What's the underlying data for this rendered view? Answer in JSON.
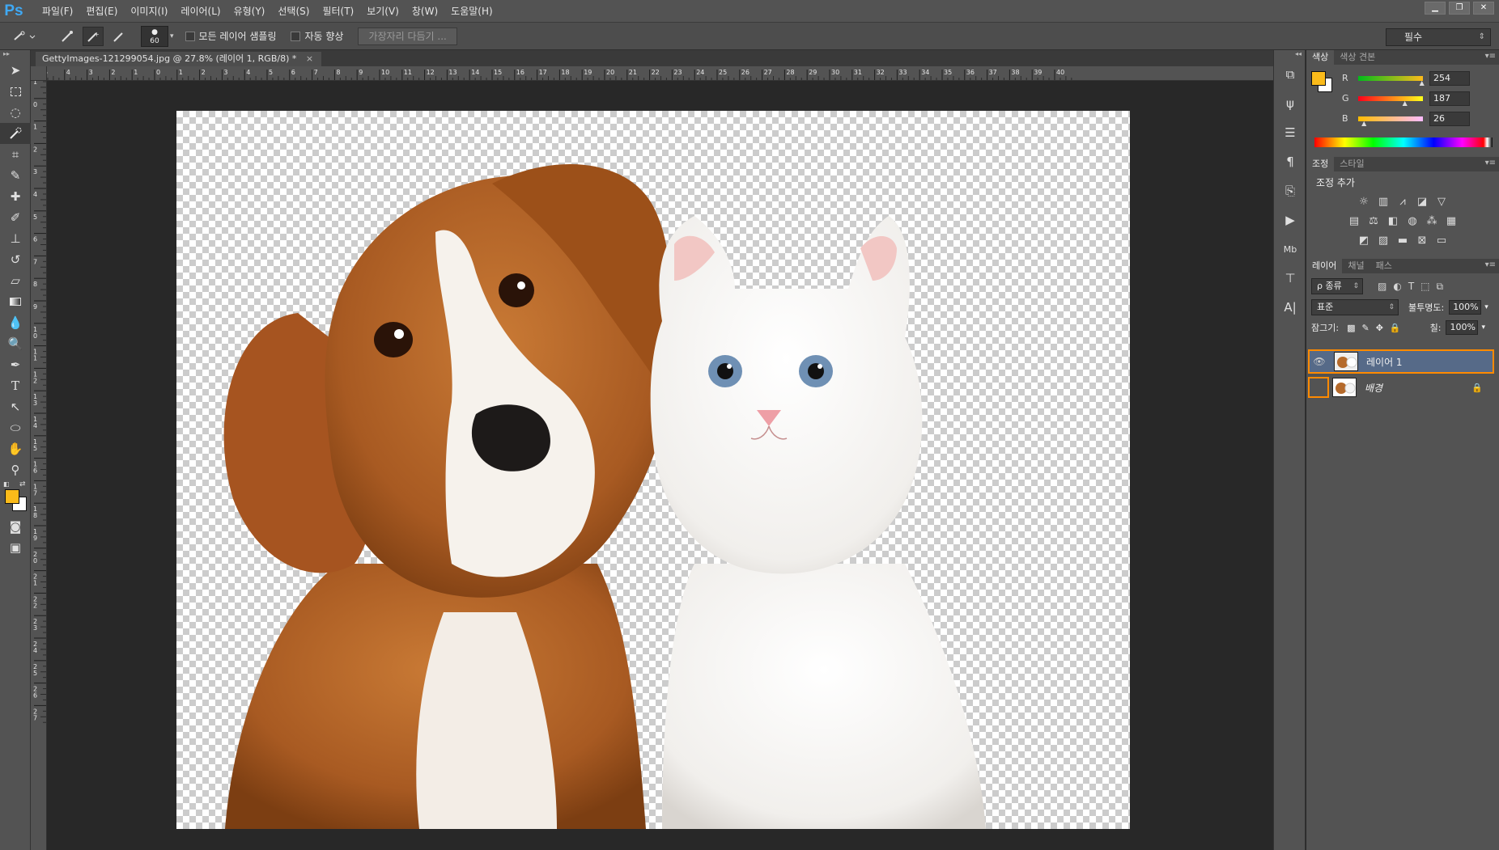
{
  "app": {
    "logo": "Ps"
  },
  "menu": [
    "파일(F)",
    "편집(E)",
    "이미지(I)",
    "레이어(L)",
    "유형(Y)",
    "선택(S)",
    "필터(T)",
    "보기(V)",
    "창(W)",
    "도움말(H)"
  ],
  "options": {
    "brush_size": "60",
    "sample_all_layers": "모든 레이어 샘플링",
    "auto_enhance": "자동 향상",
    "refine_edge": "가장자리 다듬기 ...",
    "workspace": "필수"
  },
  "document": {
    "tab_title": "GettyImages-121299054.jpg @ 27.8% (레이어 1, RGB/8) *",
    "close": "×"
  },
  "ruler": {
    "h_ticks": [
      "5",
      "4",
      "3",
      "2",
      "1",
      "0",
      "1",
      "2",
      "3",
      "4",
      "5",
      "6",
      "7",
      "8",
      "9",
      "10",
      "11",
      "12",
      "13",
      "14",
      "15",
      "16",
      "17",
      "18",
      "19",
      "20",
      "21",
      "22",
      "23",
      "24",
      "25",
      "26",
      "27",
      "28",
      "29",
      "30",
      "31",
      "32",
      "33",
      "34",
      "35",
      "36",
      "37",
      "38",
      "39",
      "40"
    ],
    "v_ticks": [
      "1",
      "0",
      "1",
      "2",
      "3",
      "4",
      "5",
      "6",
      "7",
      "8",
      "9",
      "10",
      "11",
      "12",
      "13",
      "14",
      "15",
      "16",
      "17",
      "18",
      "19",
      "20",
      "21",
      "22",
      "23",
      "24",
      "25",
      "26",
      "27"
    ]
  },
  "colors": {
    "foreground": "#fbbb1a",
    "background": "#ffffff",
    "accent": "#ff8a00"
  },
  "color_panel": {
    "tabs": [
      "색상",
      "색상 견본"
    ],
    "r_label": "R",
    "g_label": "G",
    "b_label": "B",
    "r": "254",
    "g": "187",
    "b": "26",
    "r_fraction": 0.996,
    "g_fraction": 0.733,
    "b_fraction": 0.102
  },
  "adjust_panel": {
    "tabs": [
      "조정",
      "스타일"
    ],
    "title": "조정 추가"
  },
  "layers_panel": {
    "tabs": [
      "레이어",
      "채널",
      "패스"
    ],
    "filter": "ρ 종류",
    "blend_mode": "표준",
    "opacity_label": "불투명도:",
    "opacity": "100%",
    "lock_label": "잠그기:",
    "fill_label": "칠:",
    "fill": "100%",
    "layers": [
      {
        "name": "레이어 1",
        "visible": true,
        "selected": true
      },
      {
        "name": "배경",
        "visible": false,
        "selected": false,
        "locked": true
      }
    ]
  }
}
